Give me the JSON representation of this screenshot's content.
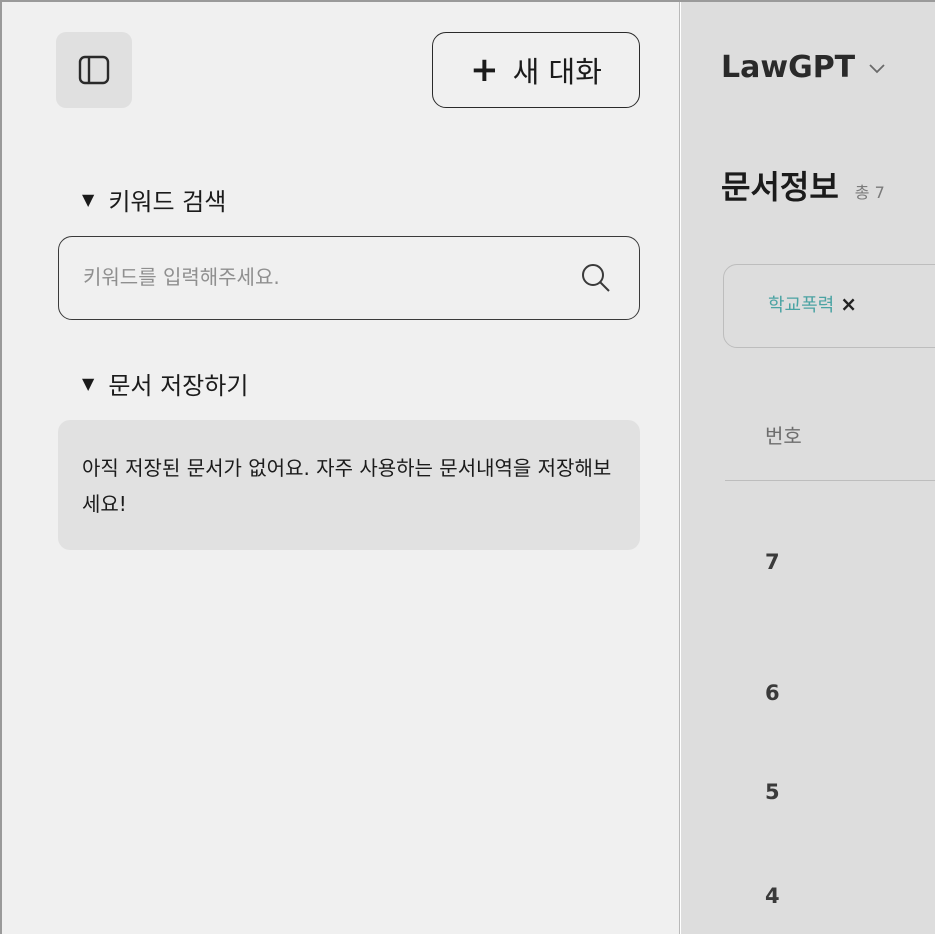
{
  "sidebar": {
    "new_chat_label": "새 대화",
    "new_chat_icon": "plus-icon",
    "toggle_icon": "sidebar-toggle-icon",
    "keyword_section": {
      "title": "키워드 검색",
      "search_placeholder": "키워드를 입력해주세요.",
      "search_value": "",
      "search_icon": "search-icon"
    },
    "saved_section": {
      "title": "문서 저장하기",
      "empty_message": "아직 저장된 문서가 없어요. 자주 사용하는 문서내역을 저장해보세요!"
    }
  },
  "main": {
    "model_name": "LawGPT",
    "model_icon": "chevron-down-icon",
    "page_title": "문서정보",
    "count_label": "총 7",
    "filter_chips": [
      {
        "label": "학교폭력",
        "remove": "×"
      }
    ],
    "table": {
      "header": "번호",
      "rows": [
        "7",
        "6",
        "5",
        "4"
      ]
    }
  },
  "colors": {
    "sidebar_bg": "#f0f0f0",
    "main_bg": "#dddddd",
    "chip_text": "#4ba3a3",
    "saved_box_bg": "#e1e1e1"
  }
}
